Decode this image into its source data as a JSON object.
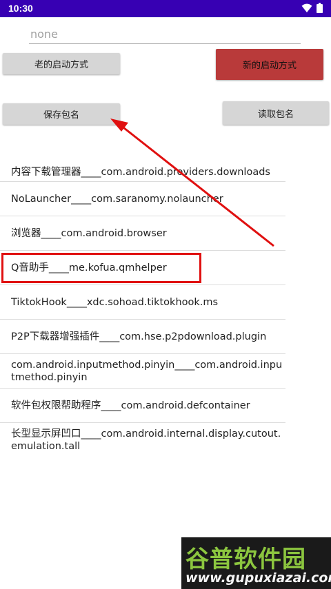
{
  "status_bar": {
    "time": "10:30",
    "icons": [
      "wifi-icon",
      "battery-icon"
    ]
  },
  "package_input": {
    "placeholder": "none"
  },
  "buttons": {
    "old_launch": "老的启动方式",
    "new_launch": "新的启动方式",
    "save_package": "保存包名",
    "read_package": "读取包名"
  },
  "apps": [
    {
      "text": "内容下载管理器____com.android.providers.downloads"
    },
    {
      "text": "NoLauncher____com.saranomy.nolauncher"
    },
    {
      "text": "浏览器____com.android.browser"
    },
    {
      "text": "Q音助手____me.kofua.qmhelper"
    },
    {
      "text": "TiktokHook____xdc.sohoad.tiktokhook.ms"
    },
    {
      "text": "P2P下载器增强插件____com.hse.p2pdownload.plugin"
    },
    {
      "text": "com.android.inputmethod.pinyin____com.android.inputmethod.pinyin"
    },
    {
      "text": "软件包权限帮助程序____com.android.defcontainer"
    },
    {
      "text": "长型显示屏凹口____com.android.internal.display.cutout.emulation.tall"
    }
  ],
  "colors": {
    "status_bar": "#3700b3",
    "new_launch_button": "#b93a3a",
    "annotation": "#e01010"
  },
  "watermark": {
    "title": "谷普软件园",
    "url": "www.gupuxiazai.com"
  }
}
